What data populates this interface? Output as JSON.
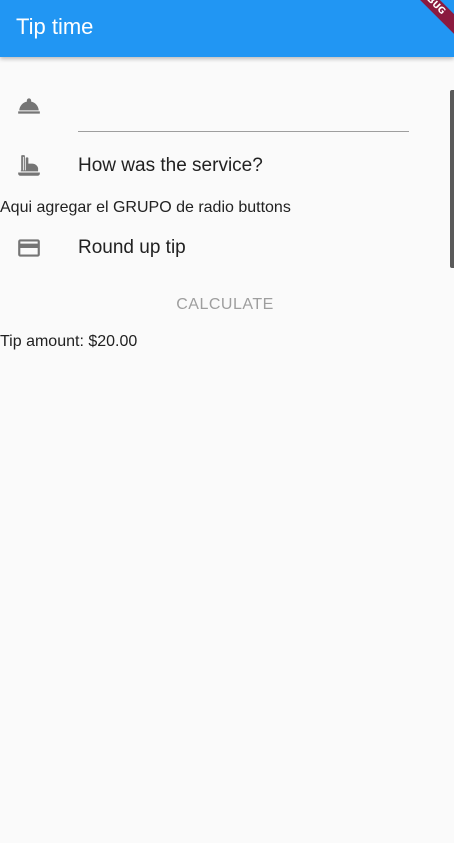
{
  "app_bar": {
    "title": "Tip time",
    "color": "#2196f3",
    "debug_banner": "DEBUG"
  },
  "form": {
    "cost_field": {
      "icon": "room-service-icon",
      "value": "",
      "placeholder": ""
    },
    "service_row": {
      "icon": "dinner-dining-icon",
      "label": "How was the service?"
    },
    "radio_note": "Aqui agregar el GRUPO de radio buttons",
    "round_up_row": {
      "icon": "credit-card-icon",
      "label": "Round up tip"
    },
    "calculate_label": "CALCULATE"
  },
  "result": {
    "tip_amount": "Tip amount: $20.00"
  }
}
